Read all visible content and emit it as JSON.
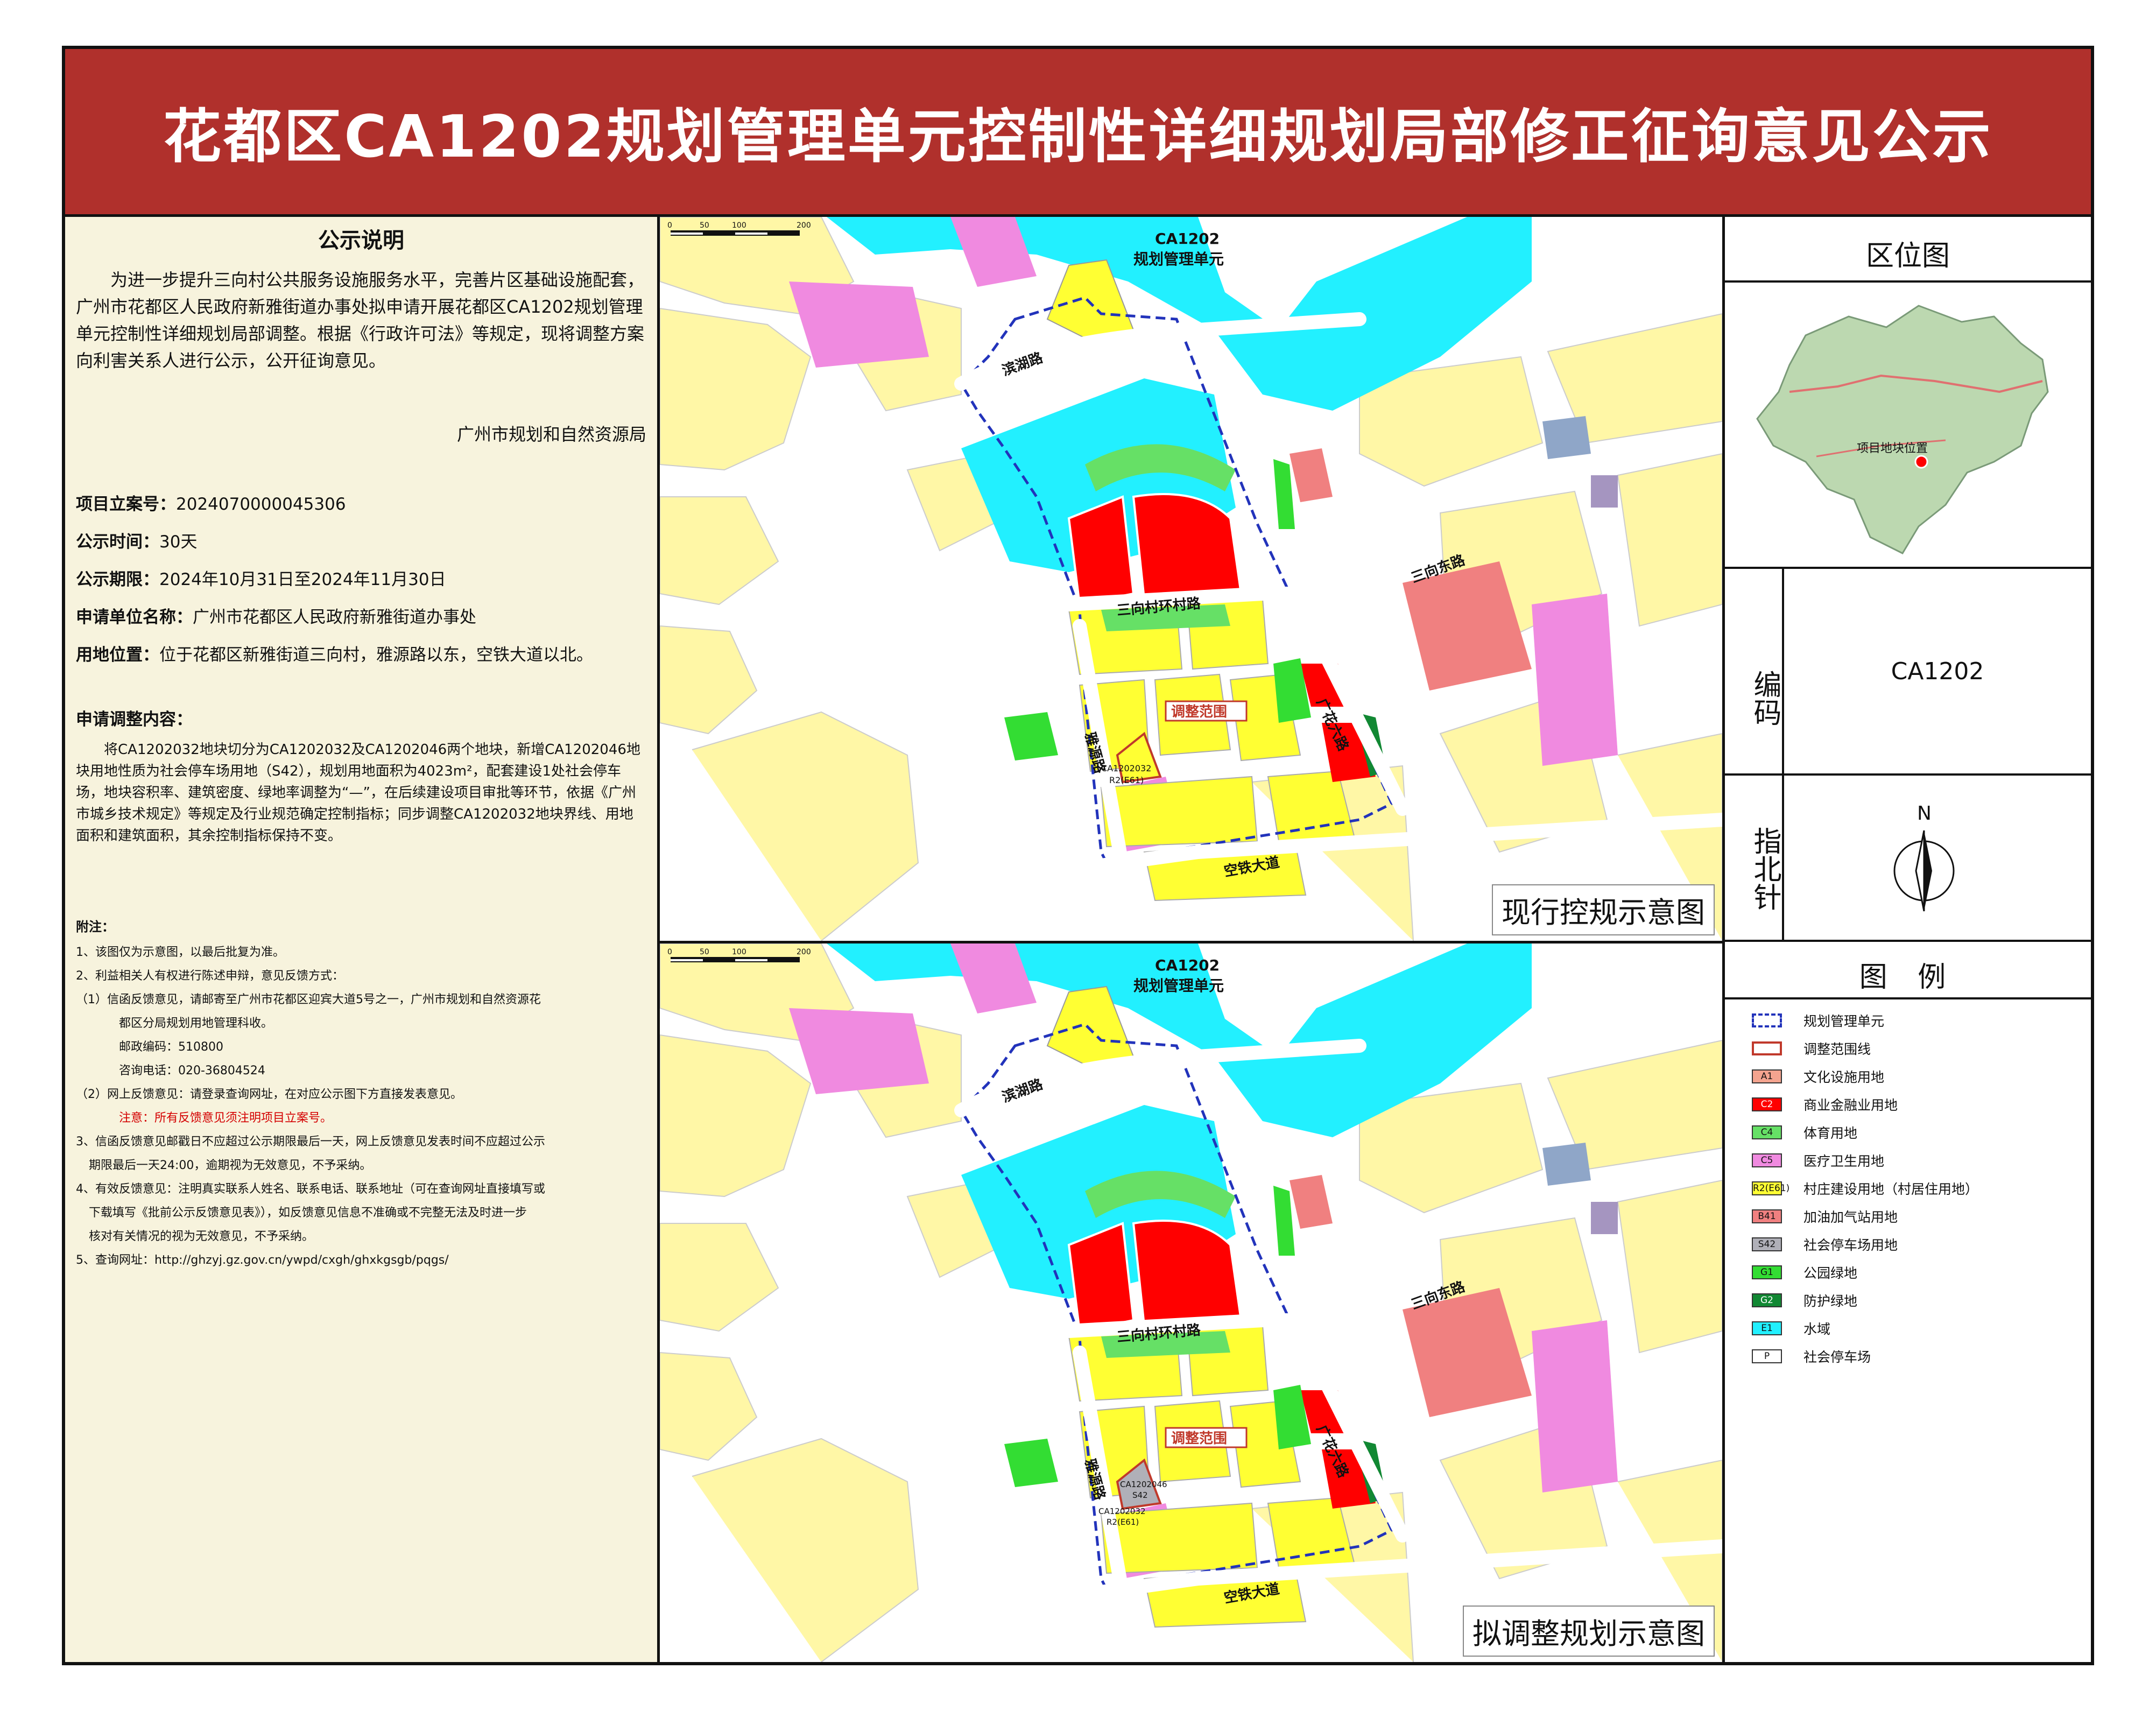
{
  "title": "花都区CA1202规划管理单元控制性详细规划局部修正征询意见公示",
  "notice": {
    "heading": "公示说明",
    "intro": "为进一步提升三向村公共服务设施服务水平，完善片区基础设施配套，广州市花都区人民政府新雅街道办事处拟申请开展花都区CA1202规划管理单元控制性详细规划局部调整。根据《行政许可法》等规定，现将调整方案向利害关系人进行公示，公开征询意见。",
    "issuer": "广州市规划和自然资源局",
    "project_no_label": "项目立案号：",
    "project_no": "2024070000045306",
    "period_label": "公示时间：",
    "period": "30天",
    "term_label": "公示期限：",
    "term": "2024年10月31日至2024年11月30日",
    "applicant_label": "申请单位名称：",
    "applicant": "广州市花都区人民政府新雅街道办事处",
    "location_label": "用地位置：",
    "location": "位于花都区新雅街道三向村，雅源路以东，空铁大道以北。",
    "content_label": "申请调整内容：",
    "content": "将CA1202032地块切分为CA1202032及CA1202046两个地块，新增CA1202046地块用地性质为社会停车场用地（S42），规划用地面积为4023m²，配套建设1处社会停车场，地块容积率、建筑密度、绿地率调整为“—”，在后续建设项目审批等环节，依据《广州市城乡技术规定》等规定及行业规范确定控制指标；同步调整CA1202032地块界线、用地面积和建筑面积，其余控制指标保持不变。"
  },
  "notes": {
    "heading": "附注：",
    "items": [
      "1、该图仅为示意图，以最后批复为准。",
      "2、利益相关人有权进行陈述申辩，意见反馈方式：",
      "（1）信函反馈意见，请邮寄至广州市花都区迎宾大道5号之一，广州市规划和自然资源花",
      "都区分局规划用地管理科收。",
      "邮政编码：510800",
      "咨询电话：020-36804524",
      "（2）网上反馈意见：请登录查询网址，在对应公示图下方直接发表意见。",
      "注意：所有反馈意见须注明项目立案号。",
      "3、信函反馈意见邮戳日不应超过公示期限最后一天，网上反馈意见发表时间不应超过公示",
      "期限最后一天24:00，逾期视为无效意见，不予采纳。",
      "4、有效反馈意见：注明真实联系人姓名、联系电话、联系地址（可在查询网址直接填写或",
      "下载填写《批前公示反馈意见表》），如反馈意见信息不准确或不完整无法及时进一步",
      "核对有关情况的视为无效意见，不予采纳。",
      "5、查询网址：http://ghzyj.gz.gov.cn/ywpd/cxgh/ghxkgsgb/pqgs/"
    ]
  },
  "colors": {
    "title_bg": "#b0302c",
    "panel_bg": "#f7f3dd",
    "A1": "#f4a48f",
    "C2": "#ff0000",
    "C4": "#66e066",
    "C5": "#f08ae0",
    "R2_E61": "#ffff33",
    "B41": "#f08080",
    "S42": "#b0b0b8",
    "G1": "#33dd33",
    "G2": "#118833",
    "E1": "#22f0ff",
    "road": "#ffffff",
    "base": "#fff7a6",
    "boundary": "#2233bb",
    "adjust": "#c0392b",
    "note_red": "#d40000"
  },
  "maps": {
    "top": {
      "caption": "现行控规示意图",
      "unit_label_1": "CA1202",
      "unit_label_2": "规划管理单元",
      "roads": [
        "滨湖路",
        "三向村环村路",
        "三向东路",
        "广花六路",
        "雅源路",
        "空铁大道"
      ],
      "adjust_label": "调整范围",
      "parcel_code": "CA1202032",
      "parcel_type": "R2(E61)",
      "scale": [
        "0",
        "50",
        "100",
        "200"
      ]
    },
    "bottom": {
      "caption": "拟调整规划示意图",
      "unit_label_1": "CA1202",
      "unit_label_2": "规划管理单元",
      "roads": [
        "滨湖路",
        "三向村环村路",
        "三向东路",
        "广花六路",
        "雅源路",
        "空铁大道"
      ],
      "adjust_label": "调整范围",
      "parcel_code": "CA1202032",
      "parcel_type": "R2(E61)",
      "new_parcel_code": "CA1202046",
      "new_parcel_type": "S42",
      "scale": [
        "0",
        "50",
        "100",
        "200"
      ]
    }
  },
  "location_map": {
    "heading": "区位图",
    "marker_label": "项目地块位置"
  },
  "code": {
    "label": "编码",
    "value": "CA1202"
  },
  "north": {
    "label": "指北针",
    "letter": "N"
  },
  "legend": {
    "heading": "图 例",
    "items": [
      {
        "code": "",
        "label": "规划管理单元",
        "icon": "dashed-blue-box"
      },
      {
        "code": "",
        "label": "调整范围线",
        "icon": "red-outline-box"
      },
      {
        "code": "A1",
        "label": "文化设施用地"
      },
      {
        "code": "C2",
        "label": "商业金融业用地"
      },
      {
        "code": "C4",
        "label": "体育用地"
      },
      {
        "code": "C5",
        "label": "医疗卫生用地"
      },
      {
        "code": "R2(E61)",
        "label": "村庄建设用地（村居住用地）"
      },
      {
        "code": "B41",
        "label": "加油加气站用地"
      },
      {
        "code": "S42",
        "label": "社会停车场用地"
      },
      {
        "code": "G1",
        "label": "公园绿地"
      },
      {
        "code": "G2",
        "label": "防护绿地"
      },
      {
        "code": "E1",
        "label": "水域"
      },
      {
        "code": "P",
        "label": "社会停车场",
        "icon": "parking-icon"
      }
    ]
  }
}
